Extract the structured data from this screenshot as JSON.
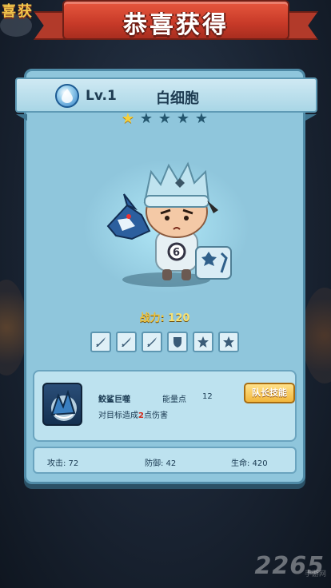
{
  "banner": {
    "title": "恭喜获得"
  },
  "background": {
    "corner_text": "喜获"
  },
  "card": {
    "level": "Lv.1",
    "name": "白细胞",
    "stars_total": 5,
    "stars_filled": 1,
    "power_label": "战力:",
    "power_value": "120",
    "equipment_slots": [
      "sword-icon",
      "sword-icon",
      "sword-icon",
      "shield-icon",
      "star-icon",
      "star-icon"
    ]
  },
  "skill": {
    "name": "鲛鲨巨噬",
    "energy_label": "能量点",
    "energy_value": "12",
    "desc_prefix": "对目标造成",
    "desc_number": "2",
    "desc_suffix": "点伤害",
    "leader_button": "队长技能"
  },
  "stats": {
    "attack": "攻击: 72",
    "defense": "防御: 42",
    "hp": "生命: 420"
  },
  "watermark": {
    "main": "2265",
    "sub": "手游网"
  },
  "colors": {
    "card_bg": "#8fc6dc",
    "ribbon": "#c73a28",
    "star_on": "#f6d03a",
    "star_off": "#24566e",
    "button_gold": "#f2b63b"
  }
}
